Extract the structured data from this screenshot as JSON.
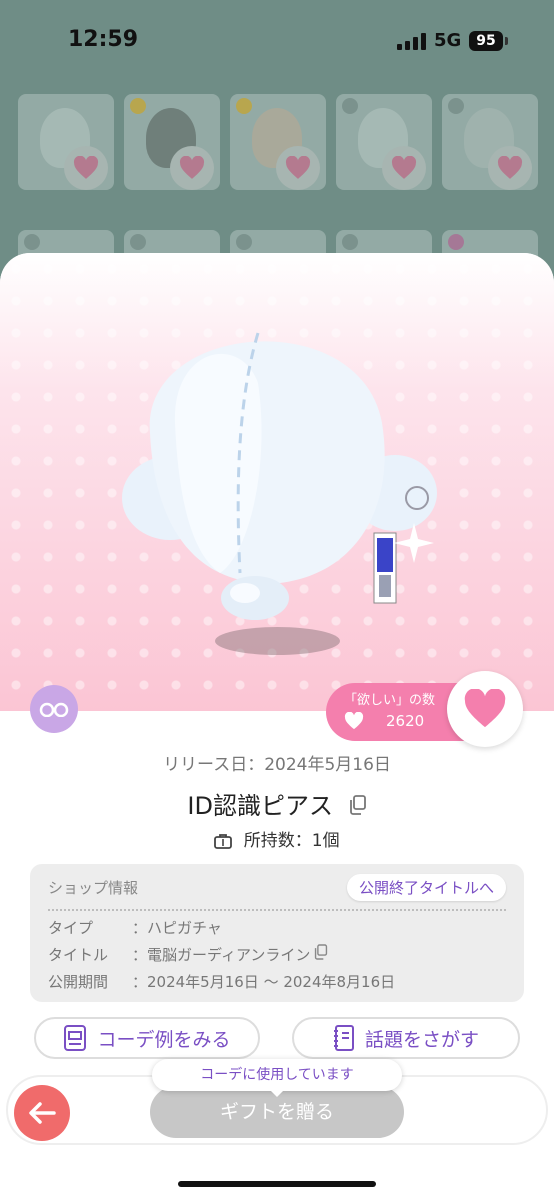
{
  "status": {
    "time": "12:59",
    "network": "5G",
    "battery": "95"
  },
  "hero": {
    "wish_label": "「欲しい」の数",
    "wish_count": "2620"
  },
  "item": {
    "release": "リリース日：2024年5月16日",
    "title": "ID認識ピアス",
    "owned": "所持数：1個"
  },
  "shop": {
    "heading": "ショップ情報",
    "end_button": "公開終了タイトルへ",
    "rows": [
      {
        "key": "タイプ",
        "value": "：ハピガチャ"
      },
      {
        "key": "タイトル",
        "value": "：電脳ガーディアンライン"
      },
      {
        "key": "公開期間",
        "value": "：2024年5月16日 〜 2024年8月16日"
      }
    ]
  },
  "actions": {
    "coord_examples": "コーデ例をみる",
    "search_topics": "話題をさがす"
  },
  "footer": {
    "tooltip": "コーデに使用しています",
    "gift": "ギフトを贈る"
  },
  "colors": {
    "accent_pink": "#f47fad",
    "accent_purple": "#7a4fc4",
    "back_red": "#f06b6b"
  }
}
